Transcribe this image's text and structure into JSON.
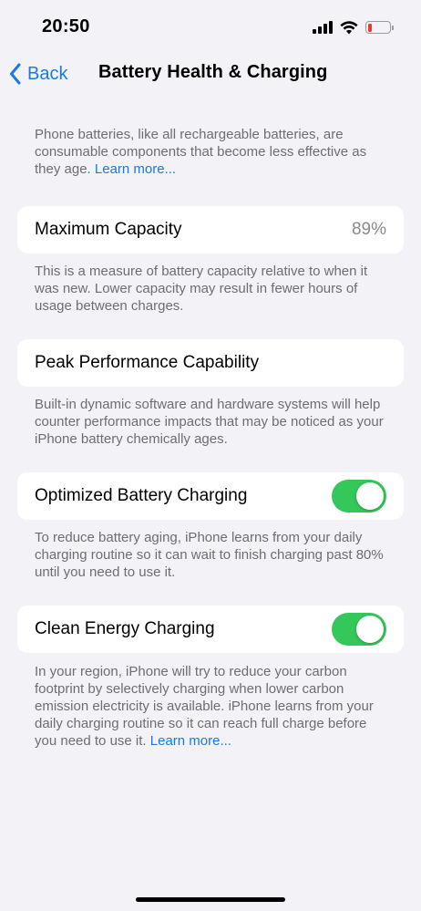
{
  "status_bar": {
    "time": "20:50",
    "battery_level_fraction": 0.2,
    "battery_color": "#eb3b30"
  },
  "nav": {
    "back_label": "Back",
    "title": "Battery Health & Charging"
  },
  "intro": {
    "text": "Phone batteries, like all rechargeable batteries, are consumable components that become less effective as they age.",
    "link": "Learn more..."
  },
  "maximum_capacity": {
    "label": "Maximum Capacity",
    "value": "89%",
    "footnote": "This is a measure of battery capacity relative to when it was new. Lower capacity may result in fewer hours of usage between charges."
  },
  "peak_performance": {
    "label": "Peak Performance Capability",
    "footnote": "Built-in dynamic software and hardware systems will help counter performance impacts that may be noticed as your iPhone battery chemically ages."
  },
  "optimized_charging": {
    "label": "Optimized Battery Charging",
    "enabled": true,
    "footnote": "To reduce battery aging, iPhone learns from your daily charging routine so it can wait to finish charging past 80% until you need to use it."
  },
  "clean_energy": {
    "label": "Clean Energy Charging",
    "enabled": true,
    "footnote": "In your region, iPhone will try to reduce your carbon footprint by selectively charging when lower carbon emission electricity is available. iPhone learns from your daily charging routine so it can reach full charge before you need to use it.",
    "link": "Learn more..."
  },
  "colors": {
    "accent": "#1a7ae0",
    "toggle_on": "#34c759",
    "background": "#f2f2f7",
    "secondary_text": "#6d6d72"
  }
}
